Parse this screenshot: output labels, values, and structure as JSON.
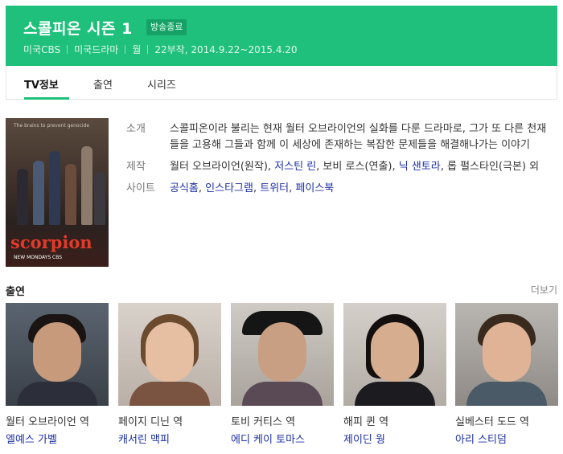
{
  "header": {
    "title": "스콜피온 시즌 1",
    "badge": "방송종료",
    "meta": [
      "미국CBS",
      "미국드라마",
      "월",
      "22부작, 2014.9.22~2015.4.20"
    ]
  },
  "tabs": [
    "TV정보",
    "출연",
    "시리즈"
  ],
  "poster": {
    "tagline": "The brains to prevent genocide",
    "logo": "scorpion",
    "subline": "NEW MONDAYS CBS"
  },
  "info": {
    "intro_label": "소개",
    "intro_text": "스콜피온이라 불리는 현재 월터 오브라이언의 실화를 다룬 드라마로, 그가 또 다른 천재들을 고용해 그들과 함께 이 세상에 존재하는 복잡한 문제들을 해결해나가는 이야기",
    "production_label": "제작",
    "production": {
      "p1": "월터 오브라이언(원작), ",
      "l1": "저스틴 린",
      "p2": ", 보비 로스(연출), ",
      "l2": "닉 샌토라",
      "p3": ", 롭 펄스타인(극본) 외"
    },
    "site_label": "사이트",
    "sites": [
      "공식홈",
      "인스타그램",
      "트위터",
      "페이스북"
    ],
    "site_sep": ", "
  },
  "cast": {
    "heading": "출연",
    "more": "더보기",
    "people": [
      {
        "role": "월터 오브라이언 역",
        "actor": "엘예스 가벨"
      },
      {
        "role": "페이지 디닌 역",
        "actor": "캐서린 맥피"
      },
      {
        "role": "토비 커티스 역",
        "actor": "에디 케이 토마스"
      },
      {
        "role": "해피 퀸 역",
        "actor": "제이딘 웡"
      },
      {
        "role": "실베스터 도드 역",
        "actor": "아리 스티덤"
      }
    ]
  }
}
